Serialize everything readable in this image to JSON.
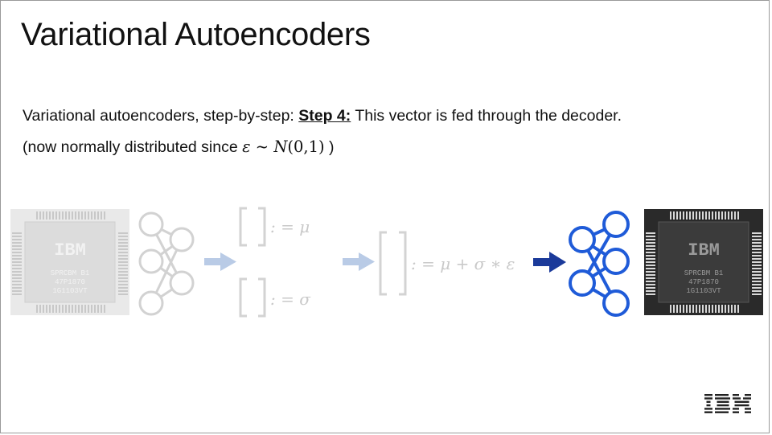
{
  "slide": {
    "title": "Variational Autoencoders",
    "line1_prefix": "Variational autoencoders, step-by-step: ",
    "line1_step": "Step 4:",
    "line1_suffix": " This vector is fed through the decoder.",
    "line2_prefix": "(now normally distributed since ",
    "line2_eps": "ε",
    "line2_sim": " ~ ",
    "line2_N": "N",
    "line2_args": "(0,1)",
    "line2_suffix": " )"
  },
  "diagram": {
    "mu_label": ": = μ",
    "sigma_label": ": = σ",
    "z_label": ": = μ + σ ∗ ε",
    "chip_text": [
      "IBM",
      "SPRCBM B1",
      "47P1870",
      "1G1103VT"
    ]
  },
  "logo": {
    "text": "IBM"
  },
  "colors": {
    "faded": "#cfcfcf",
    "faded_arrow": "#b9cbe6",
    "active_arrow": "#1b3a9a",
    "decoder": "#1f5bd8"
  }
}
